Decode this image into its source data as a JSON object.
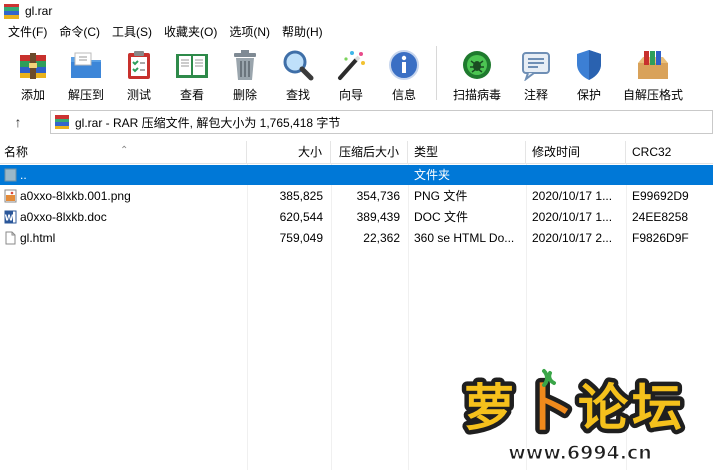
{
  "window": {
    "title": "gl.rar"
  },
  "menu": [
    {
      "id": "file",
      "label": "文件(F)"
    },
    {
      "id": "commands",
      "label": "命令(C)"
    },
    {
      "id": "tools",
      "label": "工具(S)"
    },
    {
      "id": "favorites",
      "label": "收藏夹(O)"
    },
    {
      "id": "options",
      "label": "选项(N)"
    },
    {
      "id": "help",
      "label": "帮助(H)"
    }
  ],
  "toolbar": [
    {
      "id": "add",
      "label": "添加",
      "icon": "add-archive-icon"
    },
    {
      "id": "extract",
      "label": "解压到",
      "icon": "extract-folder-icon"
    },
    {
      "id": "test",
      "label": "测试",
      "icon": "test-clipboard-icon"
    },
    {
      "id": "view",
      "label": "查看",
      "icon": "view-book-icon"
    },
    {
      "id": "delete",
      "label": "删除",
      "icon": "trash-icon"
    },
    {
      "id": "find",
      "label": "查找",
      "icon": "magnifier-icon"
    },
    {
      "id": "wizard",
      "label": "向导",
      "icon": "magic-wand-icon"
    },
    {
      "id": "info",
      "label": "信息",
      "icon": "info-icon"
    },
    {
      "id": "virus",
      "label": "扫描病毒",
      "icon": "virus-scan-icon"
    },
    {
      "id": "comment",
      "label": "注释",
      "icon": "comment-icon"
    },
    {
      "id": "protect",
      "label": "保护",
      "icon": "shield-icon"
    },
    {
      "id": "sfx",
      "label": "自解压格式",
      "icon": "sfx-archive-icon"
    }
  ],
  "address": {
    "text": "gl.rar - RAR 压缩文件, 解包大小为 1,765,418 字节"
  },
  "columns": {
    "name": "名称",
    "size": "大小",
    "packed": "压缩后大小",
    "type": "类型",
    "modified": "修改时间",
    "crc": "CRC32"
  },
  "rows": [
    {
      "name": "..",
      "size": "",
      "packed": "",
      "type": "文件夹",
      "modified": "",
      "crc": "",
      "icon": "parent-folder-icon"
    },
    {
      "name": "a0xxo-8lxkb.001.png",
      "size": "385,825",
      "packed": "354,736",
      "type": "PNG 文件",
      "modified": "2020/10/17 1...",
      "crc": "E99692D9",
      "icon": "png-file-icon"
    },
    {
      "name": "a0xxo-8lxkb.doc",
      "size": "620,544",
      "packed": "389,439",
      "type": "DOC 文件",
      "modified": "2020/10/17 1...",
      "crc": "24EE8258",
      "icon": "word-doc-icon"
    },
    {
      "name": "gl.html",
      "size": "759,049",
      "packed": "22,362",
      "type": "360 se HTML Do...",
      "modified": "2020/10/17 2...",
      "crc": "F9826D9F",
      "icon": "html-file-icon"
    }
  ],
  "watermark": {
    "brand": "萝卜论坛",
    "url": "www.6994.cn"
  },
  "colors": {
    "selection": "#0078d7",
    "accent_orange": "#f08a1c"
  }
}
